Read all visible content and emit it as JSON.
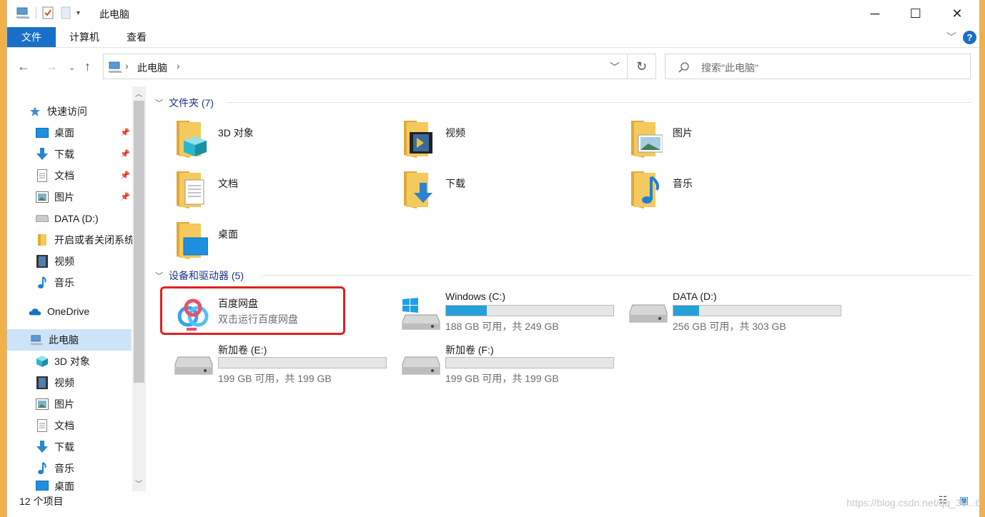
{
  "window": {
    "title": "此电脑",
    "minimize": "─",
    "maximize": "☐",
    "close": "✕"
  },
  "ribbon": {
    "tabs": [
      "文件",
      "计算机",
      "查看"
    ],
    "help": "?"
  },
  "address": {
    "path": "此电脑",
    "search_placeholder": "搜索\"此电脑\""
  },
  "sidebar": {
    "items": [
      {
        "label": "快速访问",
        "icon": "star-icon"
      },
      {
        "label": "桌面",
        "icon": "desktop-icon",
        "pinned": true
      },
      {
        "label": "下载",
        "icon": "download-icon",
        "pinned": true
      },
      {
        "label": "文档",
        "icon": "document-icon",
        "pinned": true
      },
      {
        "label": "图片",
        "icon": "picture-icon",
        "pinned": true
      },
      {
        "label": "DATA (D:)",
        "icon": "drive-icon"
      },
      {
        "label": "开启或者关闭系统",
        "icon": "folder-icon"
      },
      {
        "label": "视频",
        "icon": "video-icon"
      },
      {
        "label": "音乐",
        "icon": "music-icon"
      },
      {
        "label": "OneDrive",
        "icon": "cloud-icon"
      },
      {
        "label": "此电脑",
        "icon": "computer-icon"
      },
      {
        "label": "3D 对象",
        "icon": "cube-icon"
      },
      {
        "label": "视频",
        "icon": "video-icon"
      },
      {
        "label": "图片",
        "icon": "picture-icon"
      },
      {
        "label": "文档",
        "icon": "document-icon"
      },
      {
        "label": "下载",
        "icon": "download-icon"
      },
      {
        "label": "音乐",
        "icon": "music-icon"
      },
      {
        "label": "桌面",
        "icon": "desktop-icon"
      }
    ]
  },
  "content": {
    "folders_header": "文件夹 (7)",
    "folders": [
      "3D 对象",
      "视频",
      "图片",
      "文档",
      "下载",
      "音乐",
      "桌面"
    ],
    "devices_header": "设备和驱动器 (5)",
    "baidu": {
      "name": "百度网盘",
      "desc": "双击运行百度网盘"
    },
    "drives": [
      {
        "name": "Windows (C:)",
        "info": "188 GB 可用，共 249 GB",
        "used_fraction": 0.245
      },
      {
        "name": "DATA (D:)",
        "info": "256 GB 可用，共 303 GB",
        "used_fraction": 0.155
      },
      {
        "name": "新加卷 (E:)",
        "info": "199 GB 可用，共 199 GB",
        "used_fraction": 0.0
      },
      {
        "name": "新加卷 (F:)",
        "info": "199 GB 可用，共 199 GB",
        "used_fraction": 0.0
      }
    ]
  },
  "status": {
    "count": "12 个项目"
  },
  "watermark": "https://blog.csdn.net/qq_36...6",
  "colors": {
    "accent": "#1a6fc9",
    "highlight": "#e02020",
    "drive_fill": "#26a0da"
  }
}
